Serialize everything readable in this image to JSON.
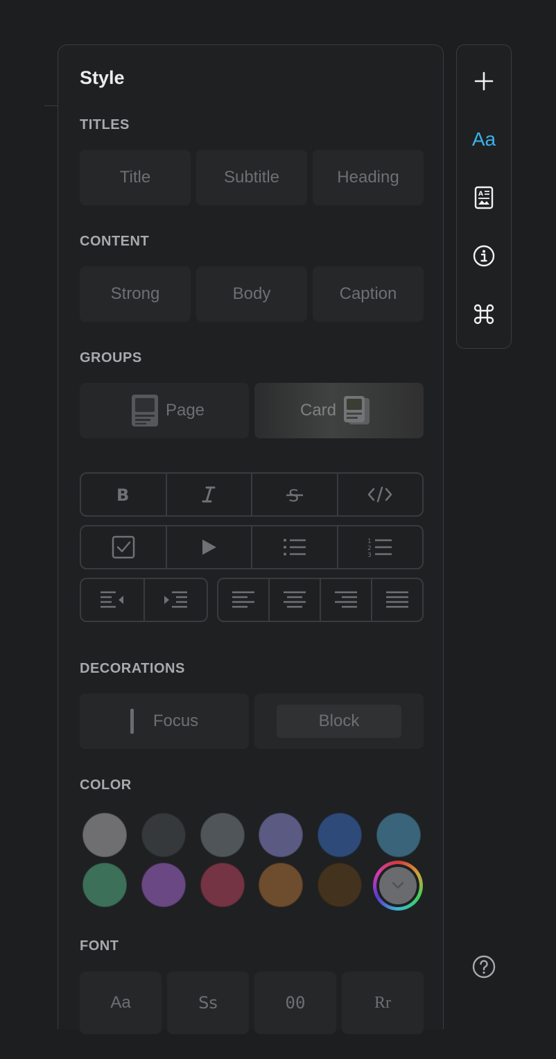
{
  "panel": {
    "title": "Style",
    "sections": {
      "titles": "TITLES",
      "content": "CONTENT",
      "groups": "GROUPS",
      "decorations": "DECORATIONS",
      "color": "COLOR",
      "font": "FONT"
    },
    "titles": [
      "Title",
      "Subtitle",
      "Heading"
    ],
    "content": [
      "Strong",
      "Body",
      "Caption"
    ],
    "groups": [
      "Page",
      "Card"
    ],
    "decorations": [
      "Focus",
      "Block"
    ],
    "fonts": [
      "Aa",
      "Ss",
      "00",
      "Rr"
    ]
  },
  "colors": {
    "accent": "#39b3ec",
    "swatches": [
      "#6f6f72",
      "#36393b",
      "#50555a",
      "#5b5a82",
      "#2e4a78",
      "#3a6479",
      "#3d7058",
      "#6a4884",
      "#743443",
      "#6e4c2e",
      "#43321e",
      "#6a6b6f"
    ]
  },
  "rail": {
    "icons": [
      "plus-icon",
      "text-style-icon",
      "page-media-icon",
      "info-icon",
      "command-icon"
    ],
    "text_style_label": "Aa"
  }
}
